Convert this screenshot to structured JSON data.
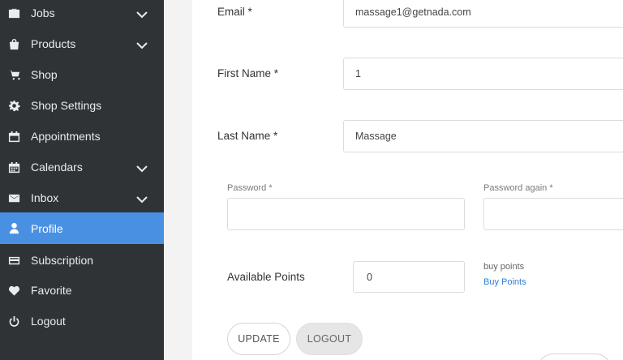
{
  "sidebar": {
    "items": [
      {
        "label": "Jobs",
        "icon": "briefcase-icon",
        "has_chevron": true,
        "active": false
      },
      {
        "label": "Products",
        "icon": "bag-icon",
        "has_chevron": true,
        "active": false
      },
      {
        "label": "Shop",
        "icon": "cart-icon",
        "has_chevron": false,
        "active": false
      },
      {
        "label": "Shop Settings",
        "icon": "gear-icon",
        "has_chevron": false,
        "active": false
      },
      {
        "label": "Appointments",
        "icon": "calendar-icon",
        "has_chevron": false,
        "active": false
      },
      {
        "label": "Calendars",
        "icon": "calendar-grid-icon",
        "has_chevron": true,
        "active": false
      },
      {
        "label": "Inbox",
        "icon": "envelope-icon",
        "has_chevron": true,
        "active": false
      },
      {
        "label": "Profile",
        "icon": "user-icon",
        "has_chevron": false,
        "active": true
      },
      {
        "label": "Subscription",
        "icon": "credit-card-icon",
        "has_chevron": false,
        "active": false
      },
      {
        "label": "Favorite",
        "icon": "heart-icon",
        "has_chevron": false,
        "active": false
      },
      {
        "label": "Logout",
        "icon": "power-icon",
        "has_chevron": false,
        "active": false
      }
    ],
    "active_color": "#4a90e2",
    "background": "#2f3336"
  },
  "form": {
    "email": {
      "label": "Email *",
      "value": "massage1@getnada.com"
    },
    "first_name": {
      "label": "First Name *",
      "value": "1"
    },
    "last_name": {
      "label": "Last Name *",
      "value": "Massage"
    },
    "password": {
      "label": "Password *",
      "value": ""
    },
    "password_again": {
      "label": "Password again *",
      "value": ""
    },
    "points": {
      "label": "Available Points",
      "value": "0",
      "buy_text": "buy points",
      "buy_link": "Buy Points"
    },
    "update_label": "UPDATE",
    "logout_label": "LOGOUT"
  }
}
